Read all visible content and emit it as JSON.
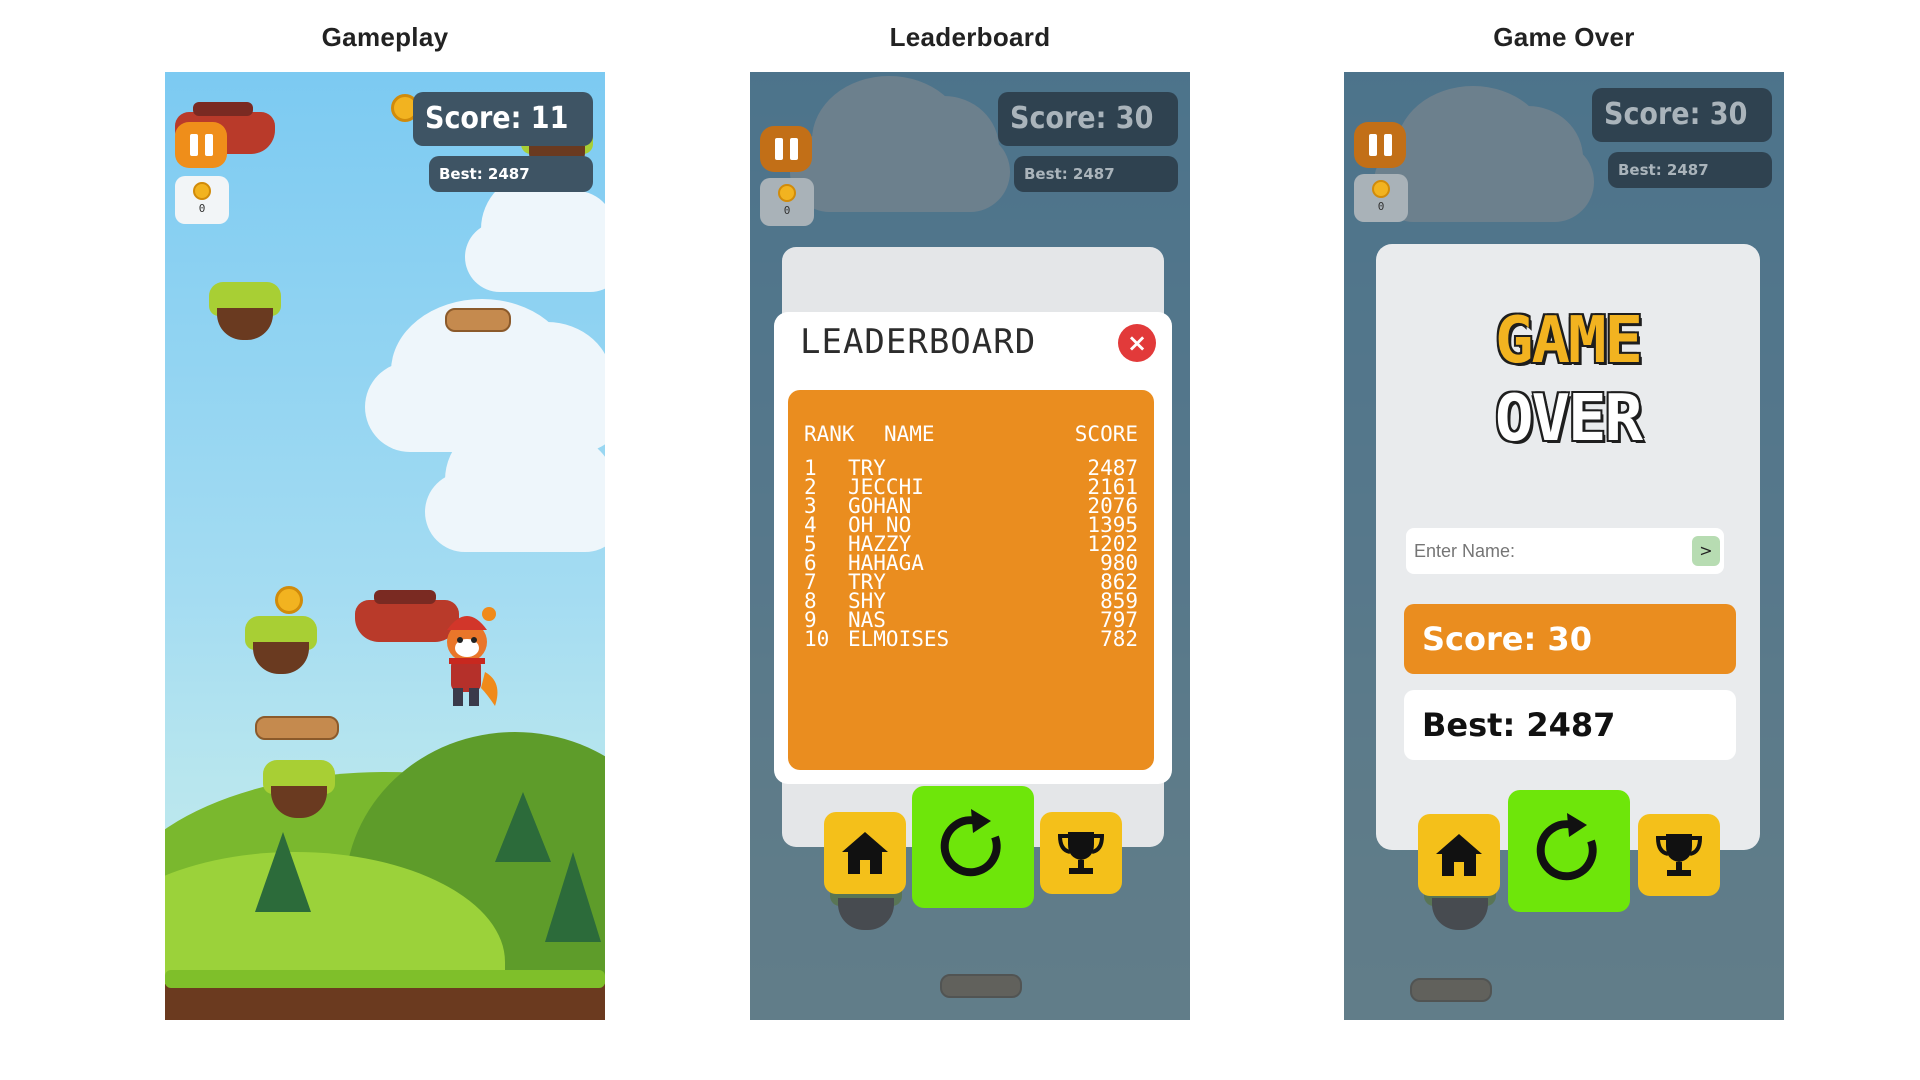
{
  "captions": {
    "gameplay": "Gameplay",
    "leaderboard": "Leaderboard",
    "game_over": "Game Over"
  },
  "gameplay": {
    "score": "Score: 11",
    "best": "Best: 2487",
    "coins": "0"
  },
  "leaderboard_screen": {
    "score": "Score: 30",
    "best": "Best: 2487",
    "coins": "0",
    "title": "LEADERBOARD",
    "close_icon": "×",
    "headers": {
      "rank": "RANK",
      "name": "NAME",
      "score": "SCORE"
    },
    "rows": [
      {
        "rank": "1",
        "name": "TRY",
        "score": "2487"
      },
      {
        "rank": "2",
        "name": "JECCHI",
        "score": "2161"
      },
      {
        "rank": "3",
        "name": "GOHAN",
        "score": "2076"
      },
      {
        "rank": "4",
        "name": "OH NO",
        "score": "1395"
      },
      {
        "rank": "5",
        "name": "HAZZY",
        "score": "1202"
      },
      {
        "rank": "6",
        "name": "HAHAGA",
        "score": "980"
      },
      {
        "rank": "7",
        "name": "TRY",
        "score": "862"
      },
      {
        "rank": "8",
        "name": "SHY",
        "score": "859"
      },
      {
        "rank": "9",
        "name": "NAS",
        "score": "797"
      },
      {
        "rank": "10",
        "name": "ELMOISES",
        "score": "782"
      }
    ]
  },
  "game_over_screen": {
    "score_pill": "Score: 30",
    "best_pill": "Best: 2487",
    "coins": "0",
    "title_line1": "GAME",
    "title_line2": "OVER",
    "name_placeholder": "Enter Name:",
    "send_label": ">",
    "score": "Score: 30",
    "best": "Best: 2487"
  },
  "icons": [
    "pause-icon",
    "coin-icon",
    "home-icon",
    "restart-icon",
    "trophy-icon",
    "close-icon",
    "send-icon"
  ],
  "colors": {
    "accent_orange": "#ea8d1f",
    "button_yellow": "#f4c01a",
    "button_green": "#6ee60a",
    "close_red": "#e23a3a",
    "hud_slate": "#3e5464"
  }
}
